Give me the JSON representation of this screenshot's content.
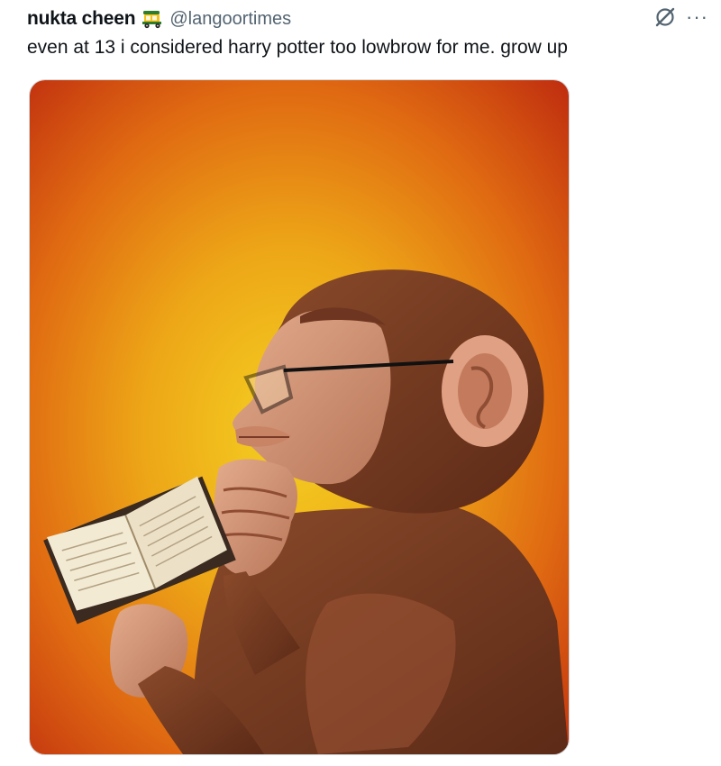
{
  "tweet": {
    "display_name": "nukta cheen",
    "badge_icon": "auto-rickshaw-icon",
    "handle": "@langoortimes",
    "text": "even at 13 i considered harry potter too lowbrow for me. grow up",
    "actions": {
      "grok_icon": "grok-icon",
      "more_label": "···"
    },
    "media": {
      "alt": "",
      "icon": "painting-chimp-reading-book",
      "colors": {
        "background_center": "#f2c21a",
        "background_edge": "#c42a10",
        "fur": "#7a3d22",
        "skin": "#d99b7d"
      }
    }
  }
}
